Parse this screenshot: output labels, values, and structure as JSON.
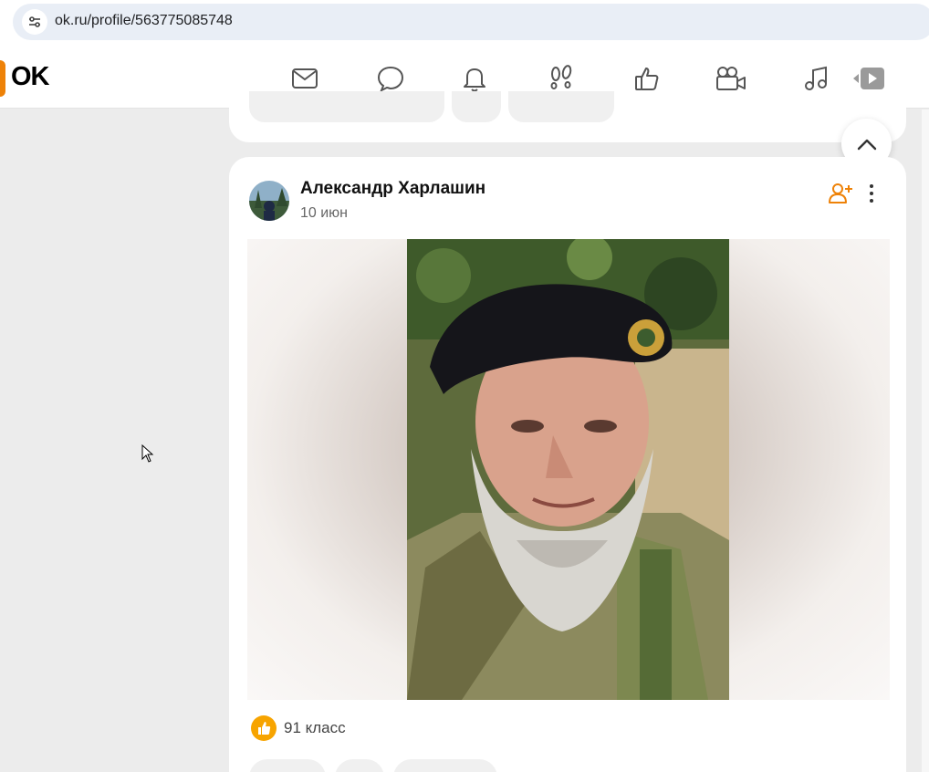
{
  "browser": {
    "url": "ok.ru/profile/563775085748",
    "site_info_icon": "tune-icon"
  },
  "header": {
    "logo_text": "OK",
    "logo_color": "#ee8208",
    "nav_icons": [
      "mail-icon",
      "chat-icon",
      "bell-icon",
      "footprints-icon",
      "thumbs-up-icon",
      "video-camera-icon",
      "music-note-icon",
      "video-play-icon"
    ]
  },
  "post": {
    "author": "Александр Харлашин",
    "date": "10 июн",
    "likes_text": "91 класс",
    "like_badge_color": "#f7a400",
    "add_friend_color": "#ee8208"
  }
}
